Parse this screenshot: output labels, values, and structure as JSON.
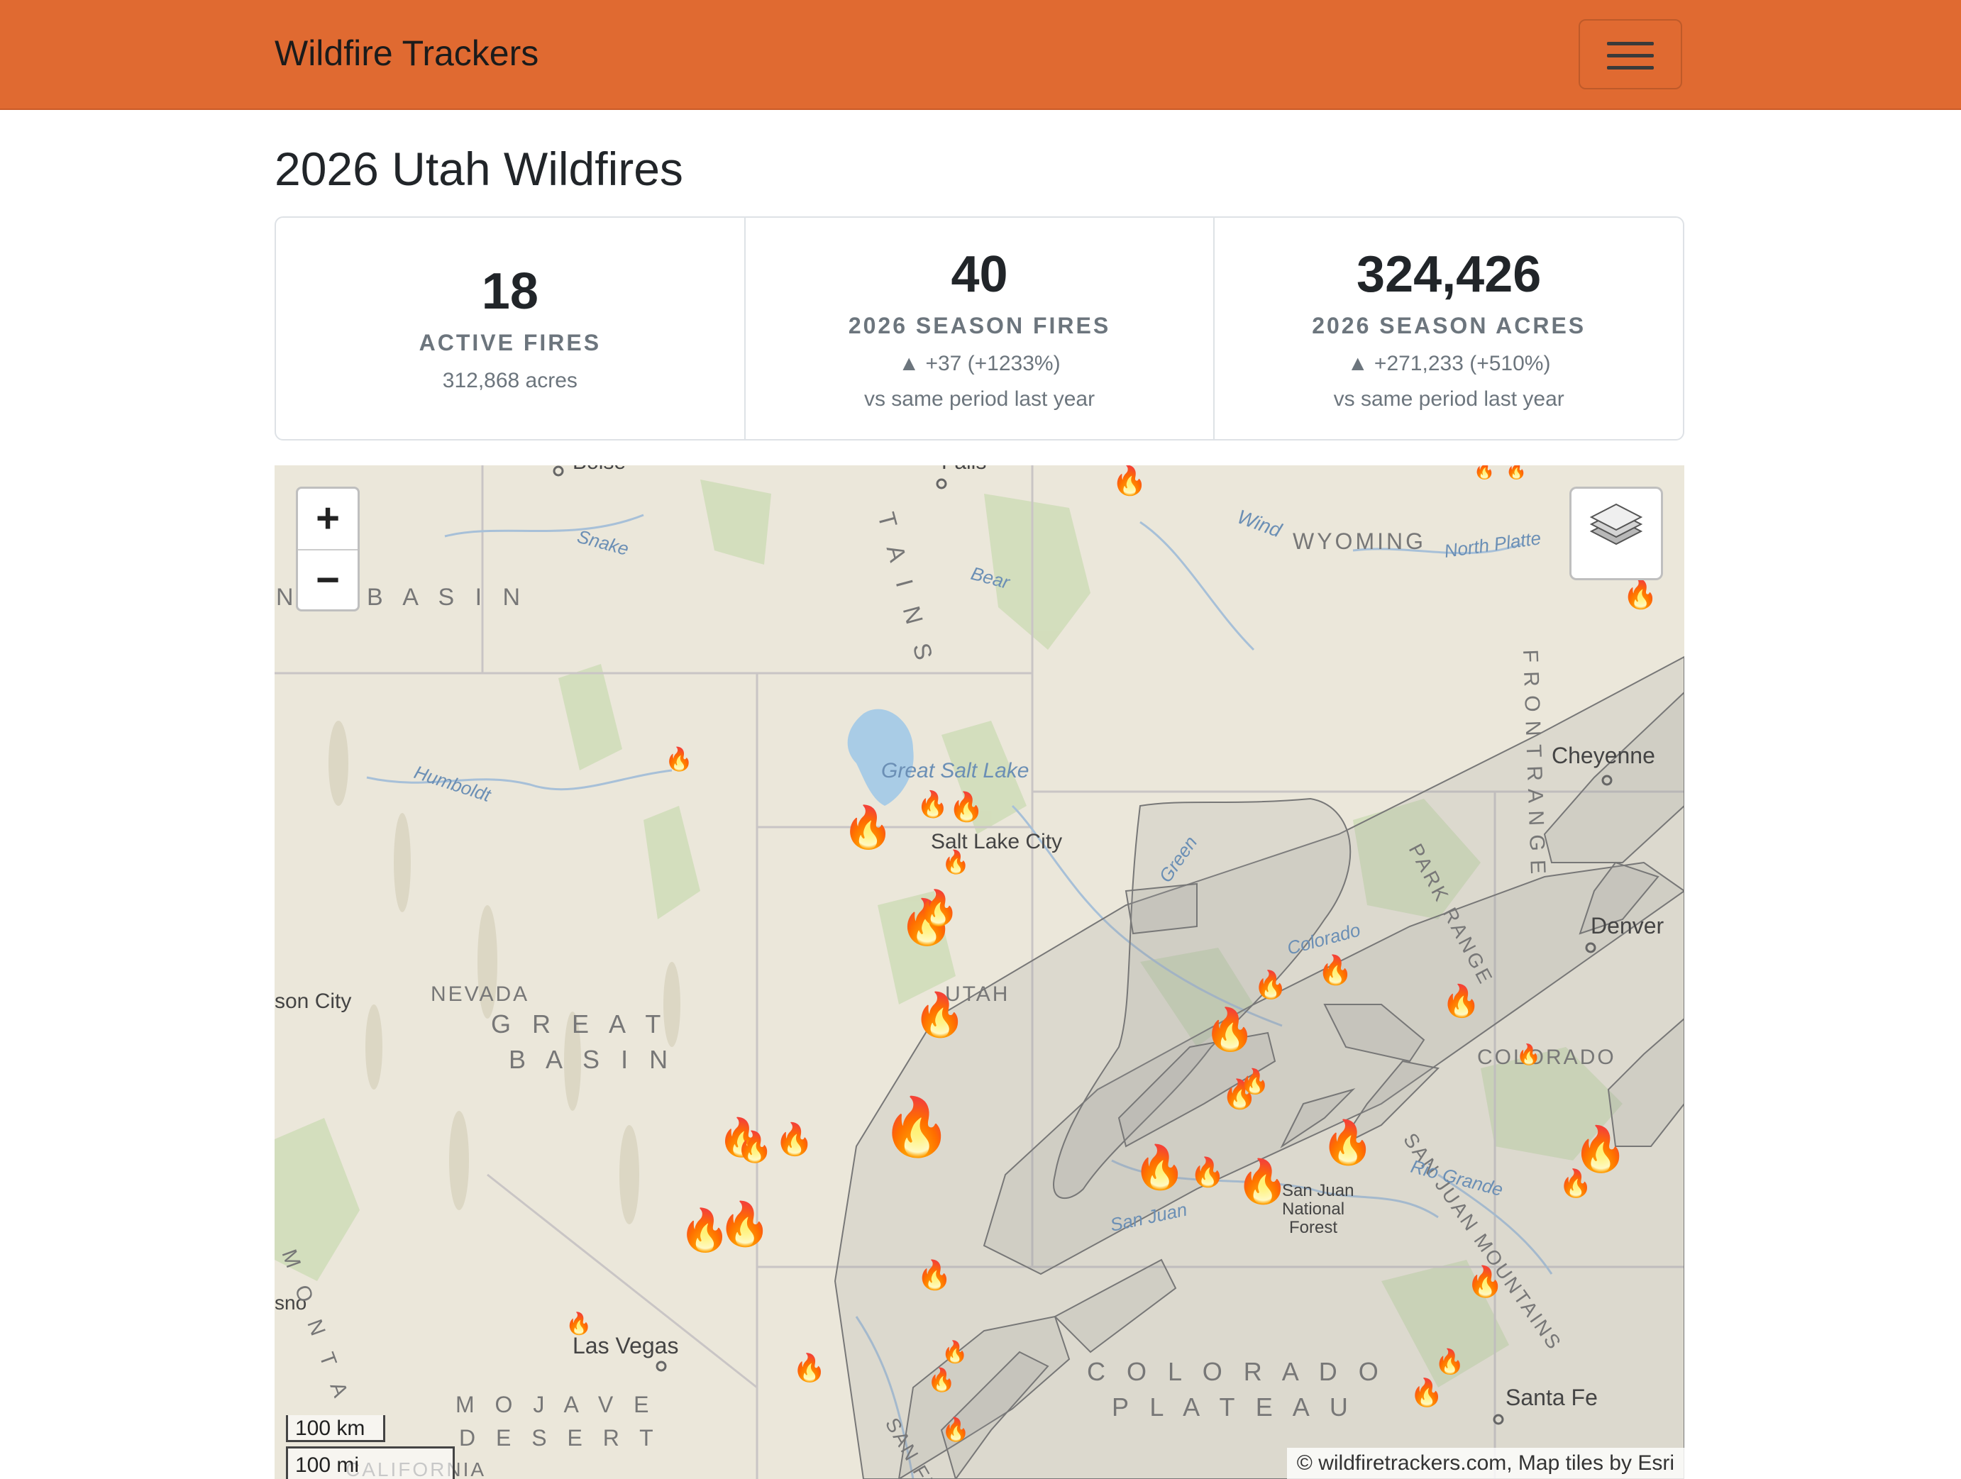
{
  "navbar": {
    "brand": "Wildfire Trackers",
    "menu_icon": "hamburger-menu-icon"
  },
  "page": {
    "title": "2026 Utah Wildfires"
  },
  "stats": {
    "active": {
      "value": "18",
      "label": "ACTIVE FIRES",
      "sub": "312,868 acres"
    },
    "season_fires": {
      "value": "40",
      "label": "2026 SEASON FIRES",
      "change": "▲ +37 (+1233%)",
      "note": "vs same period last year"
    },
    "season_acres": {
      "value": "324,426",
      "label": "2026 SEASON ACRES",
      "change": "▲ +271,233 (+510%)",
      "note": "vs same period last year"
    }
  },
  "map": {
    "zoom_in": "+",
    "zoom_out": "−",
    "layers_icon": "layers-icon",
    "fire_icon": "fire-icon",
    "scale_km": "100 km",
    "scale_mi": "100 mi",
    "attribution": "© wildfiretrackers.com, Map tiles by Esri",
    "labels": {
      "boise": "Boise",
      "falls": "Falls",
      "snake": "Snake",
      "basin_top": "B A S I N",
      "n_left": "N",
      "wyoming": "WYOMING",
      "wind": "Wind",
      "north_platte": "North Platte",
      "bear": "Bear",
      "great_salt_lake": "Great Salt Lake",
      "salt_lake_city": "Salt Lake City",
      "humboldt": "Humboldt",
      "cheyenne": "Cheyenne",
      "denver": "Denver",
      "park_range": "PARK RANGE",
      "front_range": "F R O N T   R A N G E",
      "green": "Green",
      "colorado_river": "Colorado",
      "utah": "UTAH",
      "nevada": "NEVADA",
      "carson_city": "son City",
      "great_basin_1": "G R E A T",
      "great_basin_2": "B A S I N",
      "colorado_state": "COLORADO",
      "san_juan_mountains": "SAN JUAN MOUNTAINS",
      "san_juan_nf_1": "San Juan",
      "san_juan_nf_2": "National",
      "san_juan_nf_3": "Forest",
      "rio_grande": "Rio Grande",
      "san_juan_river": "San Juan",
      "las_vegas": "Las Vegas",
      "mojave_1": "M O J A V E",
      "mojave_2": "D E S E R T",
      "colorado_plateau_1": "C O L O R A D O",
      "colorado_plateau_2": "P L A T E A U",
      "santa_fe": "Santa Fe",
      "california": "CALIFORNIA",
      "sno": "sno",
      "mountains_left": "M O N T A",
      "san_fr": "SAN FR",
      "ta_letters": "T A I N S"
    }
  }
}
